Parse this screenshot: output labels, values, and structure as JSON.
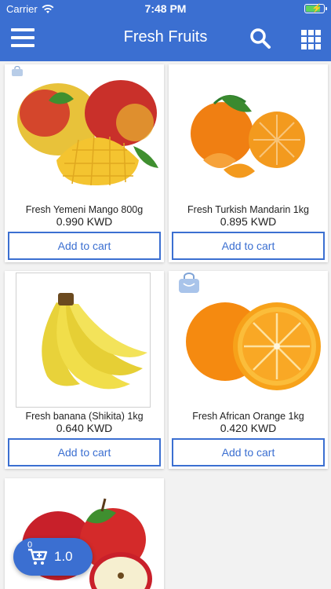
{
  "status_bar": {
    "carrier": "Carrier",
    "time": "7:48 PM"
  },
  "header": {
    "title": "Fresh Fruits",
    "menu_icon": "hamburger-menu-icon",
    "search_icon": "search-icon",
    "grid_icon": "grid-view-icon"
  },
  "colors": {
    "brand": "#3b6fd1",
    "background": "#f2f2f2"
  },
  "products": [
    {
      "name": "Fresh Yemeni Mango 800g",
      "price": "0.990 KWD",
      "button": "Add to cart"
    },
    {
      "name": "Fresh Turkish Mandarin 1kg",
      "price": "0.895 KWD",
      "button": "Add to cart"
    },
    {
      "name": "Fresh banana (Shikita) 1kg",
      "price": "0.640 KWD",
      "button": "Add to cart"
    },
    {
      "name": "Fresh African Orange 1kg",
      "price": "0.420 KWD",
      "button": "Add to cart"
    },
    {
      "name": "",
      "price": "",
      "button": ""
    }
  ],
  "cart": {
    "count": "0",
    "total": "1.0"
  }
}
